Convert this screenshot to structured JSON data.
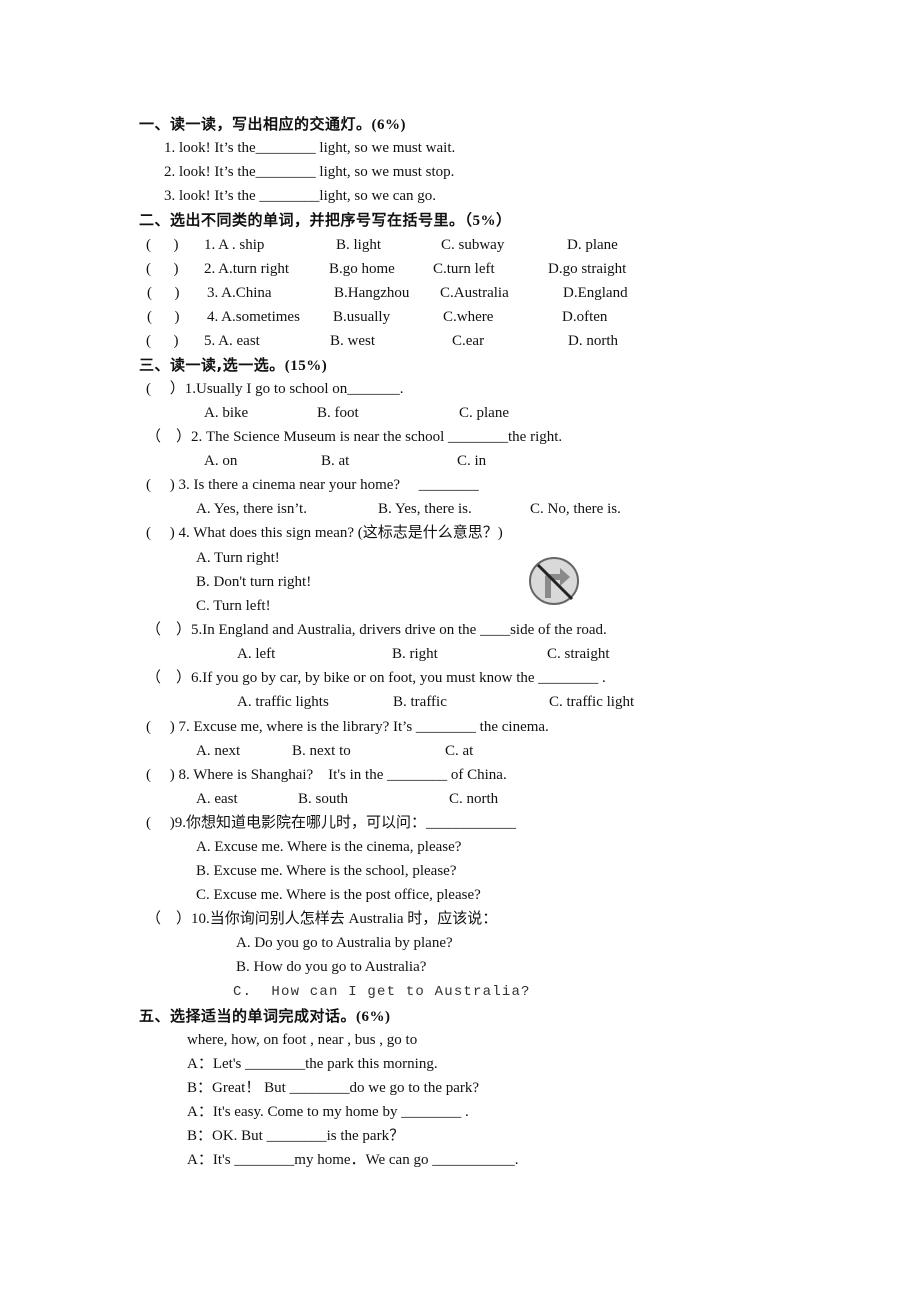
{
  "section1": {
    "heading": "一、读一读，写出相应的交通灯。",
    "score": "(6%)",
    "items": [
      "1. look! It’s the________ light, so we must wait.",
      "2. look! It’s the________ light, so we must stop.",
      "3. look! It’s the ________light, so we can go."
    ]
  },
  "section2": {
    "heading": "二、选出不同类的单词，并把序号写在括号里。",
    "score": "（5%）",
    "rows": [
      {
        "bracket": "(      )",
        "num": "1. A . ship",
        "b": "B. light",
        "c": "C. subway",
        "d": "D. plane"
      },
      {
        "bracket": "(      )",
        "num": "2. A.turn right",
        "b": "B.go home",
        "c": "C.turn left",
        "d": "D.go straight"
      },
      {
        "bracket": "(      )",
        "num": "3. A.China",
        "b": "B.Hangzhou",
        "c": "C.Australia",
        "d": "D.England"
      },
      {
        "bracket": "(      )",
        "num": "4. A.sometimes",
        "b": "B.usually",
        "c": "C.where",
        "d": "D.often"
      },
      {
        "bracket": "(      )",
        "num": "5. A. east",
        "b": "B. west",
        "c": "C.ear",
        "d": "D. north"
      }
    ]
  },
  "section3": {
    "heading": "三、读一读,选一选。",
    "score": "(15%)",
    "q1": {
      "stem": "(     ）1.Usually I go to school on_______.",
      "a": "A. bike",
      "b": "B. foot",
      "c": "C. plane"
    },
    "q2": {
      "stem": "（    ）2. The Science Museum is near the school ________the right.",
      "a": "A. on",
      "b": "B. at",
      "c": "C. in"
    },
    "q3": {
      "stem": "(     ) 3. Is there a cinema near your home?     ________",
      "a": "A. Yes, there isn’t.",
      "b": "B. Yes, there is.",
      "c": "C. No, there is."
    },
    "q4": {
      "stem": "(     ) 4. What does this sign mean? (这标志是什么意思？)",
      "a": "A. Turn right!",
      "b": "B. Don't turn right!",
      "c": "C. Turn left!",
      "sign_icon": "no-right-turn-sign"
    },
    "q5": {
      "stem": "（    ）5.In England and Australia, drivers drive on the ____side of the road.",
      "a": "A. left",
      "b": "B. right",
      "c": "C. straight"
    },
    "q6": {
      "stem": "（    ）6.If you go by car, by bike or on foot, you must know the ________ .",
      "a": "A. traffic lights",
      "b": "B. traffic",
      "c": "C. traffic light"
    },
    "q7": {
      "stem": "(     ) 7. Excuse me, where is the library? It’s ________ the cinema.",
      "a": "A. next",
      "b": "B. next to",
      "c": "C. at"
    },
    "q8": {
      "stem": "(     ) 8. Where is Shanghai?    It's in the ________ of China.",
      "a": "A. east",
      "b": "B. south",
      "c": "C. north"
    },
    "q9": {
      "stem": "(     )9.你想知道电影院在哪儿时，可以问：____________",
      "a": "A. Excuse me. Where is the cinema, please?",
      "b": "B. Excuse me. Where is the school, please?",
      "c": "C. Excuse me. Where is the post office, please?"
    },
    "q10": {
      "stem": "（    ）10.当你询问别人怎样去 Australia 时，应该说：",
      "a": "A. Do you go to Australia by plane?",
      "b": "B. How do you go to Australia?",
      "c": "C.  How can I get to Australia?"
    }
  },
  "section5": {
    "heading": "五、选择适当的单词完成对话。",
    "score": "(6%)",
    "word_bank": "where, how, on foot , near , bus , go to",
    "lines": [
      "A：Let's ________the park this morning.",
      "B：Great！ But ________do we go to the park?",
      "A：It's easy. Come to my home by ________ .",
      "B：OK. But ________is the park？",
      "A：It's ________my home．We can go ___________."
    ]
  }
}
